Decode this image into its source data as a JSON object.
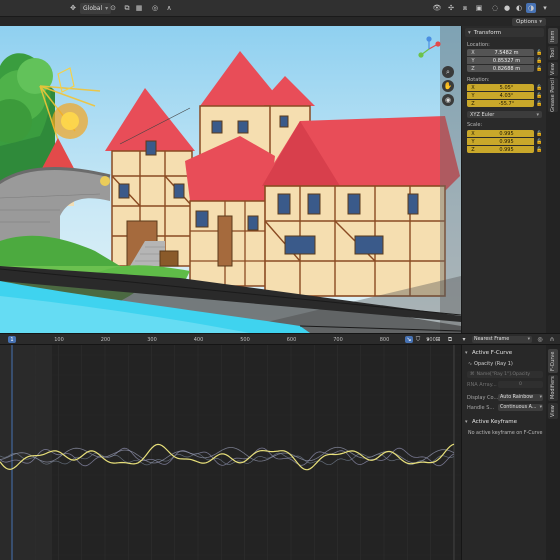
{
  "header": {
    "orientation_label": "Global",
    "options_label": "Options"
  },
  "sidebar_tabs": [
    "Item",
    "Tool",
    "View",
    "Grease Pencil"
  ],
  "transform": {
    "title": "Transform",
    "location_label": "Location:",
    "location": [
      {
        "axis": "X",
        "value": "7.5482 m"
      },
      {
        "axis": "Y",
        "value": "0.85327 m"
      },
      {
        "axis": "Z",
        "value": "0.82688 m"
      }
    ],
    "rotation_label": "Rotation:",
    "rotation": [
      {
        "axis": "X",
        "value": "5.05°"
      },
      {
        "axis": "Y",
        "value": "4.03°"
      },
      {
        "axis": "Z",
        "value": "-55.7°"
      }
    ],
    "rotation_mode": "XYZ Euler",
    "scale_label": "Scale:",
    "scale": [
      {
        "axis": "X",
        "value": "0.995"
      },
      {
        "axis": "Y",
        "value": "0.995"
      },
      {
        "axis": "Z",
        "value": "0.995"
      }
    ]
  },
  "graph_editor": {
    "frame_marker": "1",
    "frame_ticks": [
      "100",
      "200",
      "300",
      "400",
      "500",
      "600",
      "700",
      "800",
      "900"
    ],
    "snap_mode": "Nearest Frame"
  },
  "fcurve_tabs": [
    "F-Curve",
    "Modifiers",
    "View"
  ],
  "fcurve_panel": {
    "active_fcurve_title": "Active F-Curve",
    "channel_name": "Opacity (Ray 1)",
    "data_path": "Name[\"Ray 1\"].Opacity",
    "rna_array_label": "RNA Array...",
    "rna_array_value": "0",
    "display_color_label": "Display Co...",
    "display_color_value": "Auto Rainbow",
    "handle_label": "Handle S...",
    "handle_value": "Continuous A...",
    "active_keyframe_title": "Active Keyframe",
    "no_keyframe_msg": "No active keyframe on F-Curve"
  },
  "colors": {
    "accent_blue": "#4772b3",
    "selected_field": "#c9a82a",
    "curve_active": "#e8e07a"
  }
}
